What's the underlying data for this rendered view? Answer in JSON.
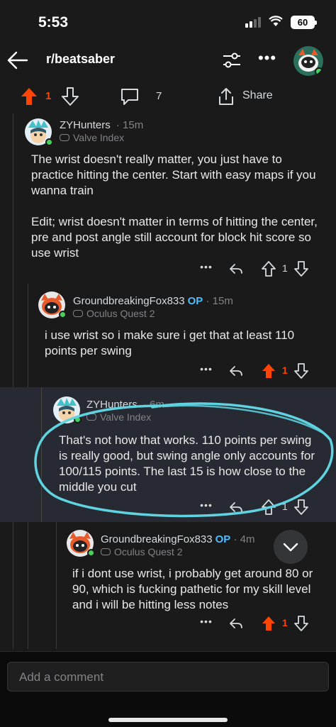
{
  "status_bar": {
    "time": "5:53",
    "battery": "60"
  },
  "nav": {
    "subreddit": "r/beatsaber",
    "icons": [
      "back-arrow-icon",
      "sort-icon",
      "more-icon",
      "avatar"
    ]
  },
  "post_actions": {
    "upvotes": "1",
    "comments": "7",
    "share_label": "Share"
  },
  "comments": [
    {
      "user": "ZYHunters",
      "meta": "· 15m",
      "op": "",
      "flair": "Valve Index",
      "body": [
        "The wrist doesn't really matter, you just have to practice hitting the center. Start with easy maps if you wanna train",
        "Edit; wrist doesn't matter in terms of hitting the center, pre and post angle still account for block hit score so use wrist"
      ],
      "votes": "1",
      "upvoted": false
    },
    {
      "user": "GroundbreakingFox833",
      "meta": "· 15m",
      "op": "OP",
      "flair": "Oculus Quest 2",
      "body": [
        "i use wrist so i make sure i get that at least 110 points per swing"
      ],
      "votes": "1",
      "upvoted": true
    },
    {
      "user": "ZYHunters",
      "meta": "· 6m",
      "op": "",
      "flair": "Valve Index",
      "body": [
        "That's not how that works. 110 points per swing is really good, but swing angle only accounts for 100/115 points. The last 15 is how close to the middle you cut"
      ],
      "votes": "1",
      "upvoted": false
    },
    {
      "user": "GroundbreakingFox833",
      "meta": "· 4m",
      "op": "OP",
      "flair": "Oculus Quest 2",
      "body": [
        "if i dont use wrist, i probably get around 80 or 90, which is fucking pathetic for my skill level and i will be hitting less notes"
      ],
      "votes": "1",
      "upvoted": true
    }
  ],
  "bottom": {
    "comment_placeholder": "Add a comment"
  },
  "colors": {
    "accent_upvote": "#ff4500",
    "op": "#4fbcff",
    "highlight_scribble": "#5fd3e0",
    "background": "#1a1a1b"
  }
}
